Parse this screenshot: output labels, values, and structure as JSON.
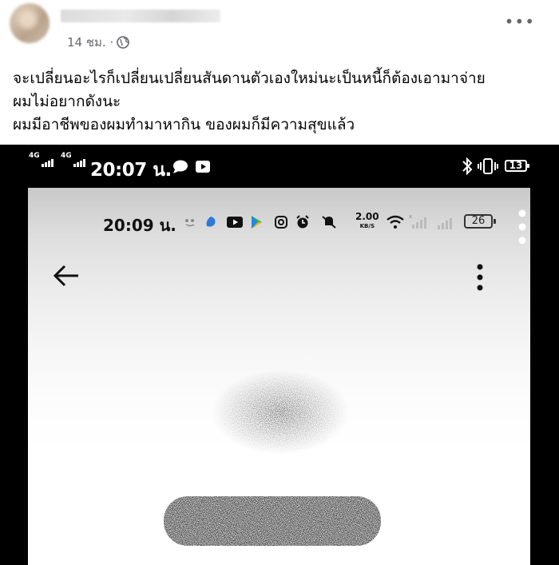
{
  "post": {
    "timestamp": "14 ชม. ·",
    "privacy_icon": "globe-icon",
    "more_icon": "more-icon",
    "text_lines": [
      "จะเปลี่ยนอะไรก็เปลี่ยนเปลี่ยนสันดานตัวเองใหม่นะเป็นหนี้ก็ต้องเอามาจ่าย",
      "ผมไม่อยากดังนะ",
      "ผมมีอาชีพของผมทำมาหากิน    ของผมก็มีความสุขแล้ว"
    ]
  },
  "photo": {
    "outer_status": {
      "net1": "4G",
      "net2": "4G",
      "time": "20:07 น.",
      "battery": "13"
    },
    "inner_status": {
      "time": "20:09 น.",
      "speed_value": "2.00",
      "speed_unit": "KB/S",
      "battery": "26"
    }
  },
  "colors": {
    "meta_gray": "#65676b",
    "photo_border": "#000000"
  }
}
